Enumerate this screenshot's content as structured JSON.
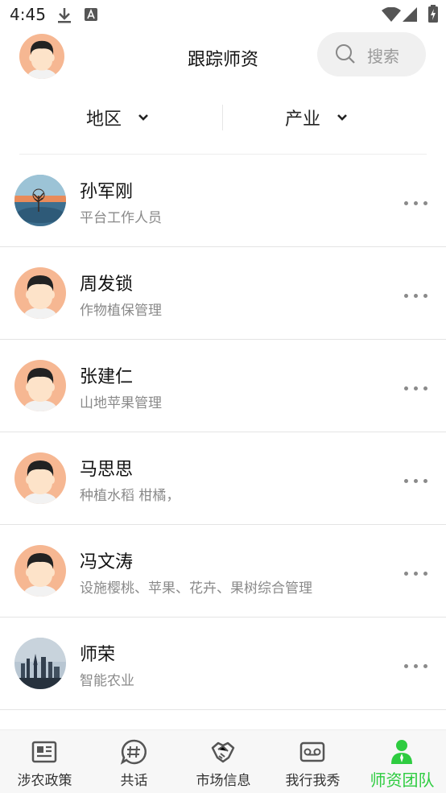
{
  "status_bar": {
    "time": "4:45"
  },
  "header": {
    "title": "跟踪师资",
    "search_placeholder": "搜索"
  },
  "filters": [
    {
      "label": "地区"
    },
    {
      "label": "产业"
    }
  ],
  "teachers": [
    {
      "name": "孙军刚",
      "desc": "平台工作人员",
      "avatar": "landscape-sunset"
    },
    {
      "name": "周发锁",
      "desc": "作物植保管理",
      "avatar": "default-person"
    },
    {
      "name": "张建仁",
      "desc": "山地苹果管理",
      "avatar": "default-person"
    },
    {
      "name": "马思思",
      "desc": "种植水稻 柑橘，",
      "avatar": "default-person"
    },
    {
      "name": "冯文涛",
      "desc": "设施樱桃、苹果、花卉、果树综合管理",
      "avatar": "default-person"
    },
    {
      "name": "师荣",
      "desc": "智能农业",
      "avatar": "city-skyline"
    }
  ],
  "nav": [
    {
      "label": "涉农政策",
      "icon": "newspaper-icon"
    },
    {
      "label": "共话",
      "icon": "hashtag-chat-icon"
    },
    {
      "label": "市场信息",
      "icon": "handshake-icon"
    },
    {
      "label": "我行我秀",
      "icon": "voicemail-icon"
    },
    {
      "label": "师资团队",
      "icon": "person-icon",
      "active": true
    }
  ],
  "colors": {
    "accent": "#2ecc40",
    "avatar_bg": "#f6b792"
  }
}
